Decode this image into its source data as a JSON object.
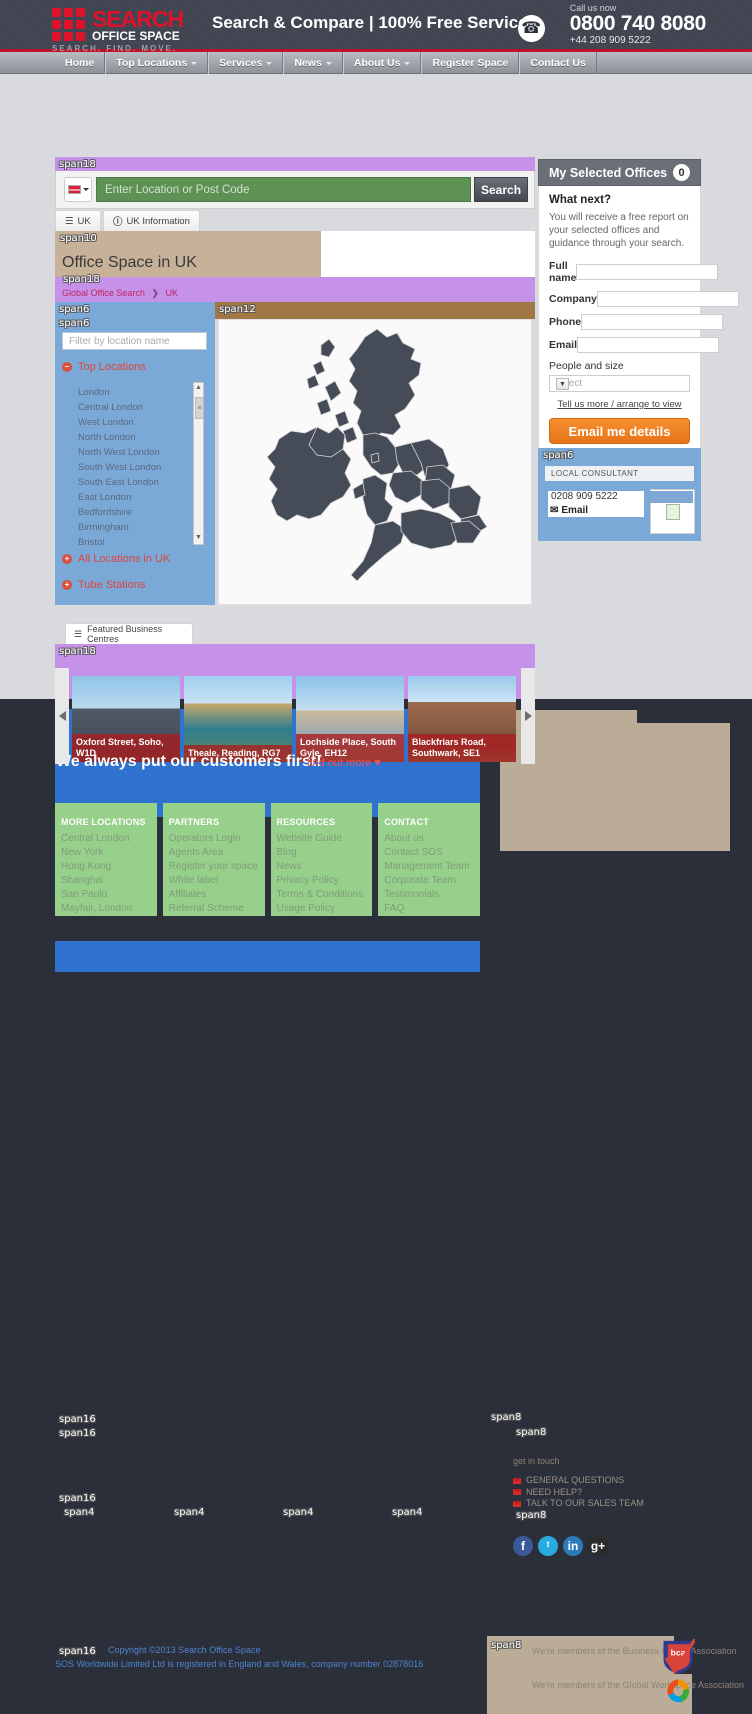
{
  "header": {
    "logo_name": "SEARCH",
    "logo_sub": "OFFICE SPACE",
    "logo_tag": "SEARCH. FIND. MOVE.",
    "tagline": "Search & Compare | 100% Free Service",
    "call_label": "Call us now",
    "phone_main": "0800 740 8080",
    "phone_sub": "+44 208 909 5222",
    "phone_icon": "phone-icon"
  },
  "nav": [
    {
      "label": "Home",
      "caret": false
    },
    {
      "label": "Top Locations",
      "caret": true
    },
    {
      "label": "Services",
      "caret": true
    },
    {
      "label": "News",
      "caret": true
    },
    {
      "label": "About Us",
      "caret": true
    },
    {
      "label": "Register Space",
      "caret": false
    },
    {
      "label": "Contact Us",
      "caret": false
    }
  ],
  "span_tags": {
    "s18_top": "span18",
    "s10_head": "span10",
    "s18_crumb": "span18",
    "s6_left_a": "span6",
    "s6_left_b": "span6",
    "s12_map": "span12",
    "s18_feat": "span18",
    "s6_lc": "span6",
    "s16_a": "span16",
    "s16_b": "span16",
    "s16_c": "span16",
    "s16_copy": "span16",
    "s4_1": "span4",
    "s4_2": "span4",
    "s4_3": "span4",
    "s4_4": "span4",
    "s8_git_a": "span8",
    "s8_git_b": "span8",
    "s8_soc": "span8",
    "s8_mem": "span8"
  },
  "search": {
    "placeholder": "Enter Location or Post Code",
    "value": "",
    "button": "Search",
    "flag_icon": "uk-flag-icon"
  },
  "tabs": [
    {
      "label": "UK",
      "icon": "list-icon",
      "active": true
    },
    {
      "label": "UK Information",
      "icon": "info-icon",
      "active": false
    }
  ],
  "page_title": "Office Space in UK",
  "breadcrumb": {
    "root": "Global Office Search",
    "sep": "❯",
    "current": "UK"
  },
  "left_panel": {
    "filter_placeholder": "Filter by location name",
    "filter_value": "",
    "section_title": "Top Locations",
    "locations": [
      "London",
      "Central London",
      "West London",
      "North London",
      "North West London",
      "South West London",
      "South East London",
      "East London",
      "Bedfordshire",
      "Birmingham",
      "Bristol"
    ],
    "all_locations": "All Locations in UK",
    "tube_stations": "Tube Stations"
  },
  "featured": {
    "tab_label": "Featured Business Centres",
    "cards": [
      {
        "caption": "Oxford Street, Soho, W1D"
      },
      {
        "caption": "Theale, Reading, RG7"
      },
      {
        "caption": "Lochside Place, South Gyle, EH12"
      },
      {
        "caption": "Blackfriars Road, Southwark, SE1"
      }
    ],
    "prev_icon": "chevron-left-icon",
    "next_icon": "chevron-right-icon"
  },
  "sidebar": {
    "title": "My Selected Offices",
    "count": "0",
    "what_next": "What next?",
    "blurb": "You will receive a free report on your selected offices and guidance through your search.",
    "fields": [
      {
        "label": "Full name",
        "value": ""
      },
      {
        "label": "Company",
        "value": ""
      },
      {
        "label": "Phone",
        "value": ""
      },
      {
        "label": "Email",
        "value": ""
      }
    ],
    "select_label": "People and size",
    "select_value": "select",
    "tell_us": "Tell us more / arrange to view",
    "submit": "Email me details",
    "accent": "#e8731a"
  },
  "consultant": {
    "title": "LOCAL CONSULTANT",
    "phone": "0208 909 5222",
    "email_label": "Email",
    "email_icon": "envelope-icon"
  },
  "footer": {
    "customers_heading": "We always put our customers first!",
    "customers_link": "find out more ♥",
    "columns": [
      {
        "title": "MORE LOCATIONS",
        "links": [
          "Central London",
          "New York",
          "Hong Kong",
          "Shanghai",
          "Sao Paulo",
          "Mayfair, London"
        ]
      },
      {
        "title": "PARTNERS",
        "links": [
          "Operators Login",
          "Agents Area",
          "Register your space",
          "White label",
          "Affiliates",
          "Referral Scheme"
        ]
      },
      {
        "title": "RESOURCES",
        "links": [
          "Website Guide",
          "Blog",
          "News",
          "Privacy Policy",
          "Terms & Conditions",
          "Usage Policy"
        ]
      },
      {
        "title": "CONTACT",
        "links": [
          "About us",
          "Contact SOS",
          "Management Team",
          "Corporate Team",
          "Testimonials",
          "FAQ"
        ]
      }
    ],
    "get_in_touch": "get in touch",
    "touch_links": [
      "GENERAL QUESTIONS",
      "NEED HELP?",
      "TALK TO OUR SALES TEAM"
    ],
    "socials": [
      {
        "name": "facebook-icon",
        "glyph": "f",
        "color": "#3b5998"
      },
      {
        "name": "twitter-icon",
        "glyph": "ᵗ",
        "color": "#29aae1"
      },
      {
        "name": "linkedin-icon",
        "glyph": "in",
        "color": "#2b7bb9"
      },
      {
        "name": "googleplus-icon",
        "glyph": "g+",
        "color": "#2b2b2b"
      }
    ],
    "copyright": "Copyright ©2013 Search Office Space",
    "registration": "SOS Worldwide Limited Ltd is registered in England and Wales, company number 02878016",
    "memberships": [
      {
        "text": "We're members of the Business Centre Association",
        "badge": "bca-logo"
      },
      {
        "text": "We're members of the Global Workspace Association",
        "badge": "gwa-logo"
      }
    ]
  }
}
